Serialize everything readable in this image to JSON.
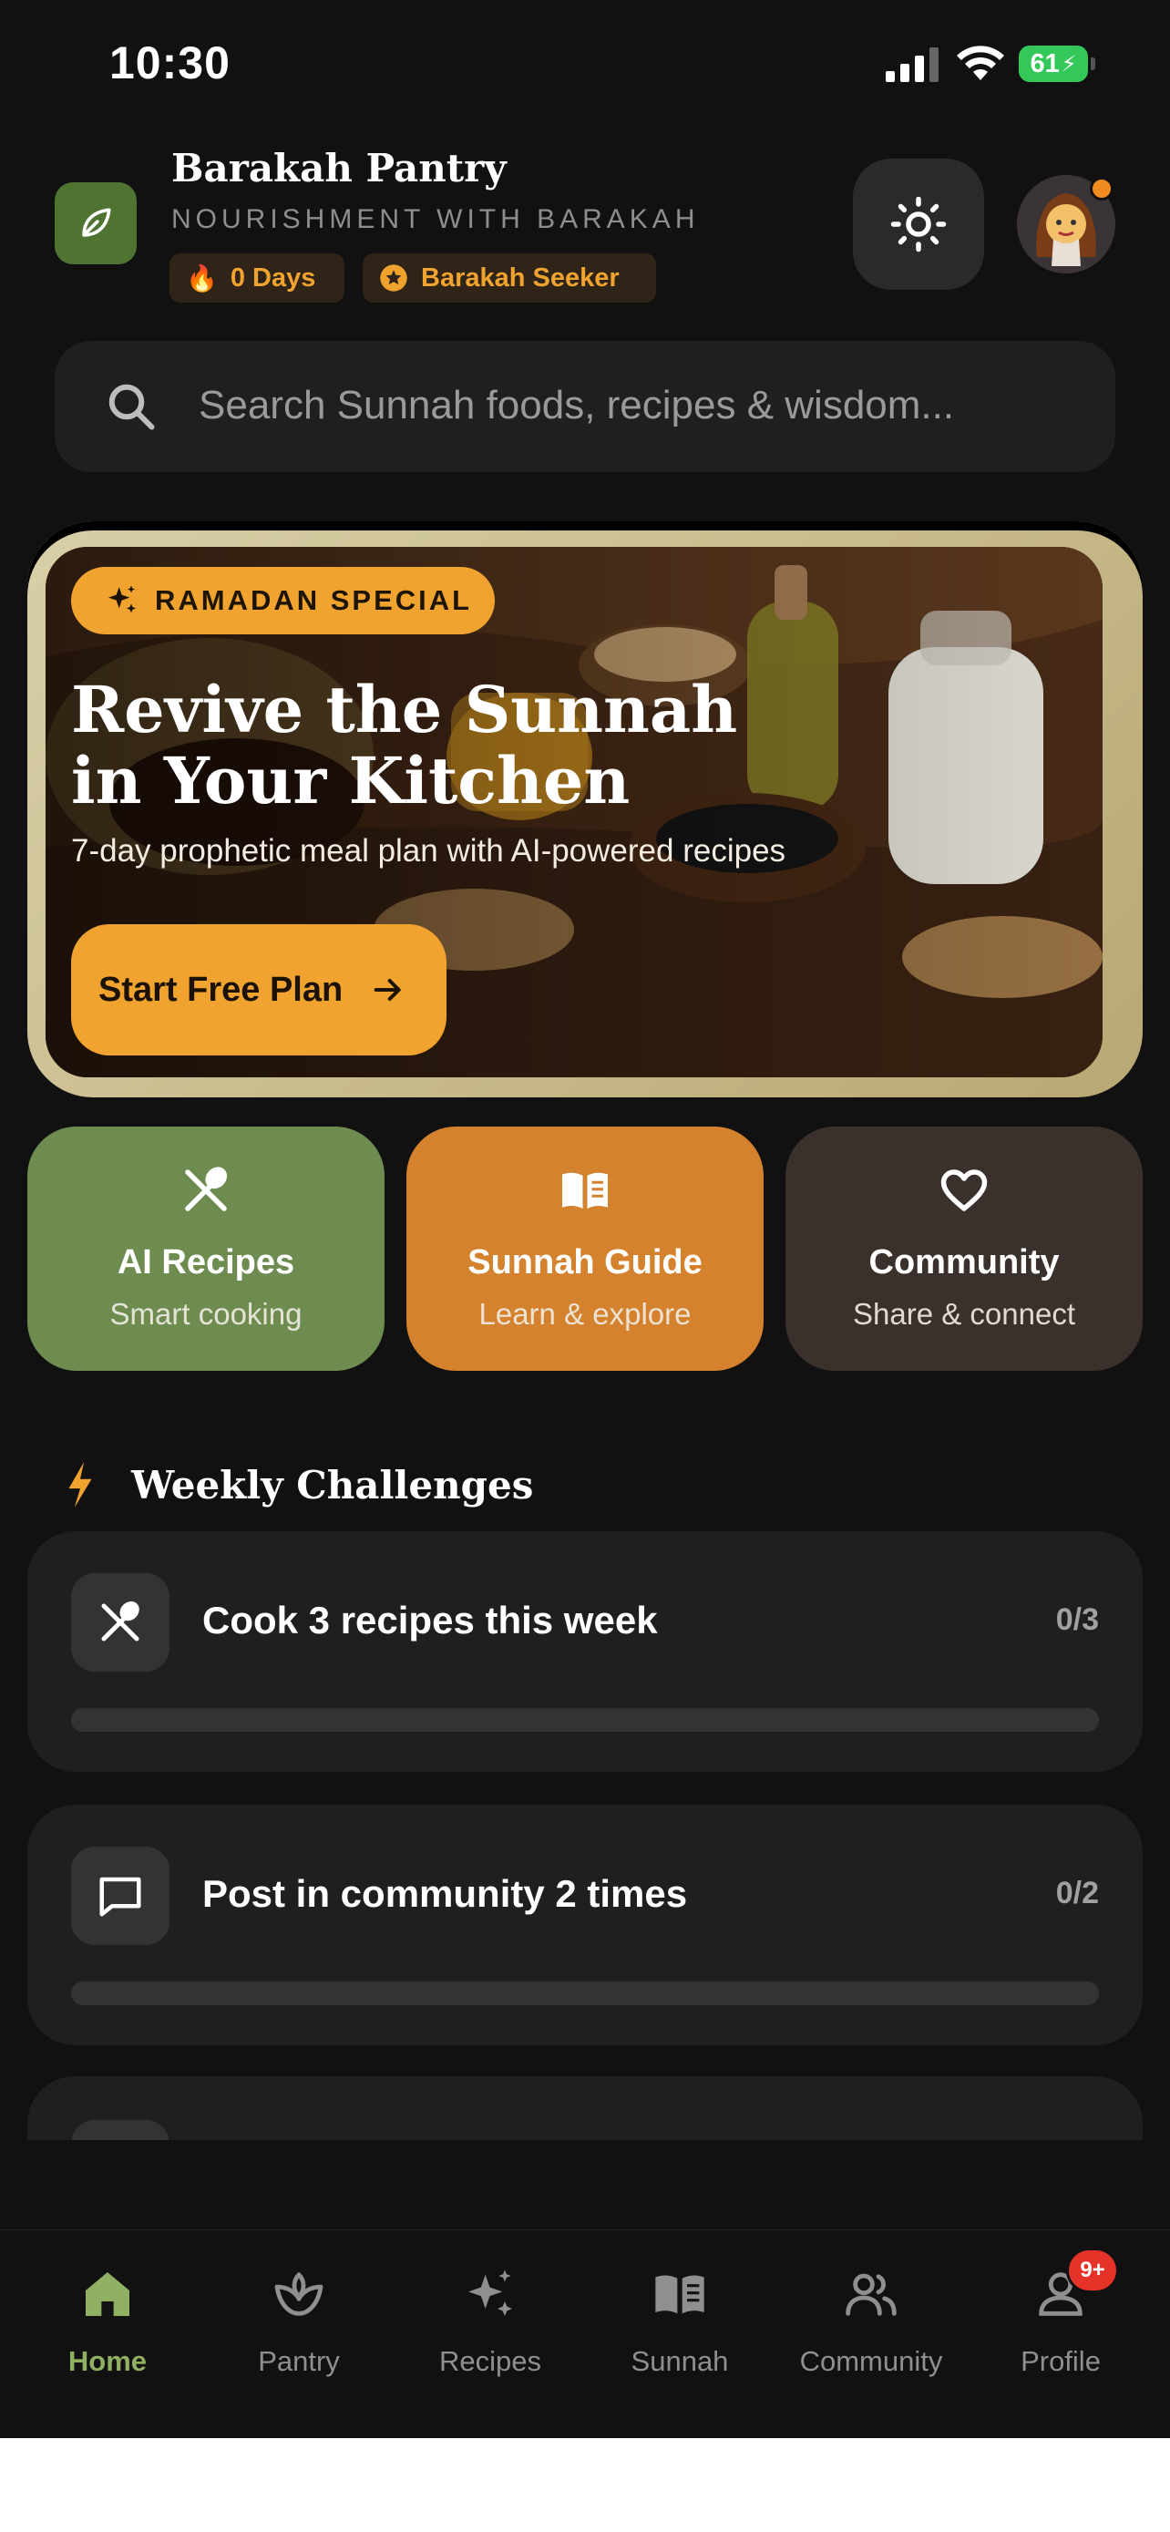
{
  "status_bar": {
    "time": "10:30",
    "battery": "61"
  },
  "header": {
    "app_title": "Barakah Pantry",
    "tagline": "NOURISHMENT WITH BARAKAH",
    "streak": "0 Days",
    "rank": "Barakah Seeker",
    "icons": {
      "logo": "leaf-icon",
      "theme": "sun-icon",
      "streak": "flame-icon",
      "rank": "star-badge-icon"
    }
  },
  "search": {
    "placeholder": "Search Sunnah foods, recipes & wisdom..."
  },
  "hero": {
    "badge": "RAMADAN SPECIAL",
    "title_line1": "Revive the Sunnah",
    "title_line2": "in Your Kitchen",
    "subtitle": "7-day prophetic meal plan with AI-powered recipes",
    "cta": "Start Free Plan"
  },
  "tiles": [
    {
      "title": "AI Recipes",
      "subtitle": "Smart cooking",
      "icon": "utensils-icon",
      "color": "#6f8c50"
    },
    {
      "title": "Sunnah Guide",
      "subtitle": "Learn & explore",
      "icon": "book-icon",
      "color": "#d4822d"
    },
    {
      "title": "Community",
      "subtitle": "Share & connect",
      "icon": "heart-icon",
      "color": "#3a302c"
    }
  ],
  "challenges": {
    "title": "Weekly Challenges",
    "items": [
      {
        "title": "Cook 3 recipes this week",
        "count": "0/3",
        "progress": 0,
        "icon": "utensils-icon"
      },
      {
        "title": "Post in community 2 times",
        "count": "0/2",
        "progress": 0,
        "icon": "chat-bubble-icon"
      }
    ]
  },
  "nav": {
    "items": [
      {
        "label": "Home",
        "icon": "home-icon",
        "active": true
      },
      {
        "label": "Pantry",
        "icon": "sprout-icon"
      },
      {
        "label": "Recipes",
        "icon": "sparkles-icon"
      },
      {
        "label": "Sunnah",
        "icon": "book-icon"
      },
      {
        "label": "Community",
        "icon": "users-icon"
      },
      {
        "label": "Profile",
        "icon": "user-icon"
      }
    ],
    "profile_badge": "9+"
  },
  "colors": {
    "accent": "#f0a42f",
    "green": "#6f8c50",
    "active_nav": "#8fb062",
    "background": "#111111"
  }
}
